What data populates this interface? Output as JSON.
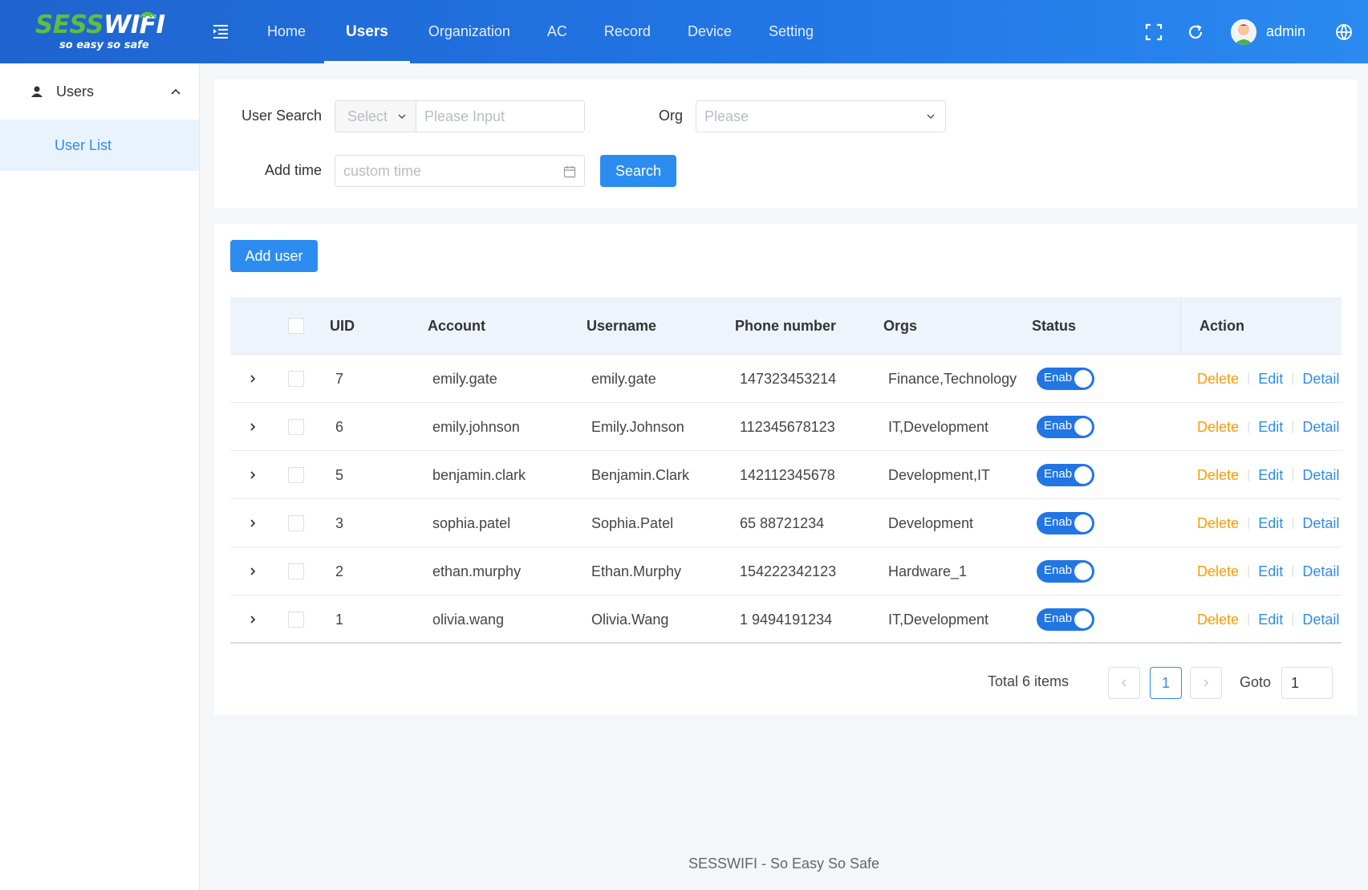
{
  "logo": {
    "part1": "SESS",
    "part2": "WIFI",
    "tagline": "so easy so safe"
  },
  "nav": {
    "items": [
      {
        "label": "Home"
      },
      {
        "label": "Users",
        "active": true
      },
      {
        "label": "Organization"
      },
      {
        "label": "AC"
      },
      {
        "label": "Record"
      },
      {
        "label": "Device"
      },
      {
        "label": "Setting"
      }
    ],
    "user": "admin"
  },
  "icons": {
    "menu_toggle": "menu-fold-icon",
    "fullscreen": "fullscreen-icon",
    "refresh": "refresh-icon",
    "language": "globe-icon",
    "calendar": "calendar-icon"
  },
  "sidebar": {
    "group": {
      "label": "Users"
    },
    "items": [
      {
        "label": "User List",
        "active": true
      }
    ]
  },
  "search": {
    "user_search_label": "User Search",
    "select_placeholder": "Select",
    "input_placeholder": "Please Input",
    "org_label": "Org",
    "org_placeholder": "Please",
    "add_time_label": "Add time",
    "time_placeholder": "custom time",
    "search_button": "Search"
  },
  "table": {
    "add_button": "Add user",
    "columns": {
      "uid": "UID",
      "account": "Account",
      "username": "Username",
      "phone": "Phone number",
      "orgs": "Orgs",
      "status": "Status",
      "action": "Action"
    },
    "rows": [
      {
        "uid": "7",
        "account": "emily.gate",
        "username": "emily.gate",
        "phone": "147323453214",
        "orgs": "Finance,Technology",
        "status": "Enab"
      },
      {
        "uid": "6",
        "account": "emily.johnson",
        "username": "Emily.Johnson",
        "phone": "112345678123",
        "orgs": "IT,Development",
        "status": "Enab"
      },
      {
        "uid": "5",
        "account": "benjamin.clark",
        "username": "Benjamin.Clark",
        "phone": "142112345678",
        "orgs": "Development,IT",
        "status": "Enab"
      },
      {
        "uid": "3",
        "account": "sophia.patel",
        "username": "Sophia.Patel",
        "phone": "65 88721234",
        "orgs": "Development",
        "status": "Enab"
      },
      {
        "uid": "2",
        "account": "ethan.murphy",
        "username": "Ethan.Murphy",
        "phone": "154222342123",
        "orgs": "Hardware_1",
        "status": "Enab"
      },
      {
        "uid": "1",
        "account": "olivia.wang",
        "username": "Olivia.Wang",
        "phone": "1 9494191234",
        "orgs": "IT,Development",
        "status": "Enab"
      }
    ],
    "actions": {
      "delete": "Delete",
      "edit": "Edit",
      "detail": "Detail"
    }
  },
  "pagination": {
    "total": "Total 6 items",
    "current": "1",
    "goto_label": "Goto",
    "goto_value": "1"
  },
  "footer": "SESSWIFI - So Easy So Safe",
  "colors": {
    "primary": "#2d8cf0",
    "header": "#2277e6",
    "delete": "#ff9900",
    "logo_green": "#5fbf3c"
  }
}
